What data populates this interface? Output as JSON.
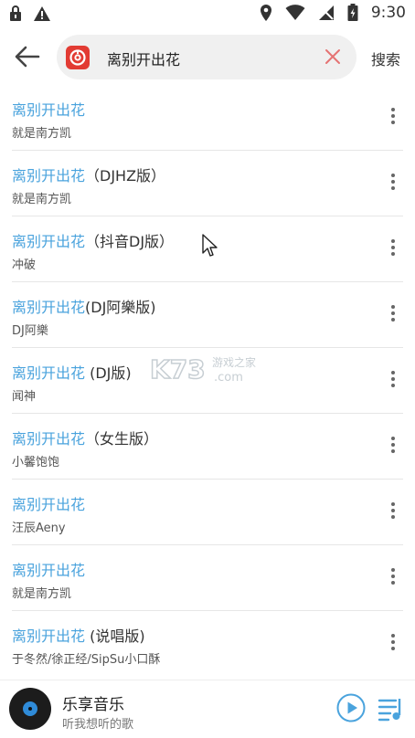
{
  "status_bar": {
    "time": "9:30"
  },
  "header": {
    "search_value": "离别开出花",
    "search_button": "搜索"
  },
  "results": [
    {
      "title_hl": "离别开出花",
      "title_rest": "",
      "artist": "就是南方凯"
    },
    {
      "title_hl": "离别开出花",
      "title_rest": "（DJHZ版）",
      "artist": "就是南方凯"
    },
    {
      "title_hl": "离别开出花",
      "title_rest": "（抖音DJ版）",
      "artist": "冲破"
    },
    {
      "title_hl": "离别开出花",
      "title_rest": "(DJ阿樂版)",
      "artist": "DJ阿樂"
    },
    {
      "title_hl": "离别开出花",
      "title_rest": " (DJ版)",
      "artist": "闻神"
    },
    {
      "title_hl": "离别开出花",
      "title_rest": "（女生版）",
      "artist": "小馨饱饱"
    },
    {
      "title_hl": "离别开出花",
      "title_rest": "",
      "artist": "汪辰Aeny"
    },
    {
      "title_hl": "离别开出花",
      "title_rest": "",
      "artist": "就是南方凯"
    },
    {
      "title_hl": "离别开出花",
      "title_rest": " (说唱版)",
      "artist": "于冬然/徐正经/SipSu小口酥"
    }
  ],
  "watermark": {
    "brand": "K73",
    "cn": "游戏之家",
    "domain": ".com"
  },
  "player": {
    "title": "乐享音乐",
    "subtitle": "听我想听的歌"
  },
  "colors": {
    "accent": "#4aa3dd",
    "logo_red": "#e23b33"
  }
}
